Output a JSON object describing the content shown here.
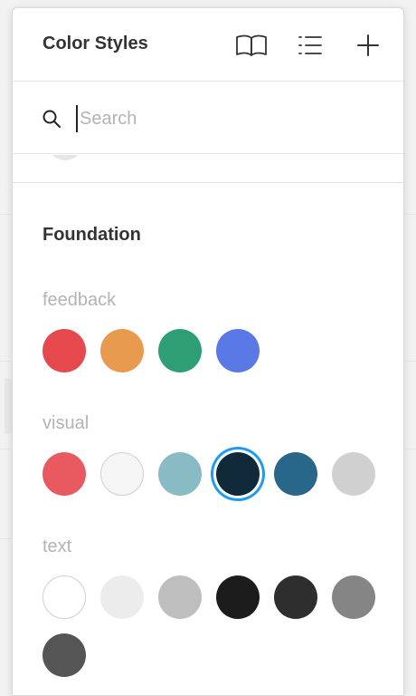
{
  "header": {
    "title": "Color Styles",
    "buttons": [
      "book-icon",
      "list-icon",
      "plus-icon"
    ]
  },
  "search": {
    "placeholder": "Search",
    "value": ""
  },
  "section": {
    "title": "Foundation",
    "groups": [
      {
        "label": "feedback",
        "colors": [
          "#e5484d",
          "#e89a4f",
          "#2e9e75",
          "#5a78e6"
        ]
      },
      {
        "label": "visual",
        "colors": [
          "#e85a5f",
          "#f5f5f5",
          "#88bbc4",
          "#102a3a",
          "#28668a",
          "#d0d0d0"
        ],
        "selected_index": 3
      },
      {
        "label": "text",
        "colors": [
          "#ffffff",
          "#ececec",
          "#bebebe",
          "#1c1c1c",
          "#2e2e2e",
          "#858585",
          "#555555"
        ]
      }
    ]
  },
  "colors": {
    "selection_ring": "#1e9bf0",
    "title_text": "#333333",
    "muted_text": "#b3b3b3"
  }
}
